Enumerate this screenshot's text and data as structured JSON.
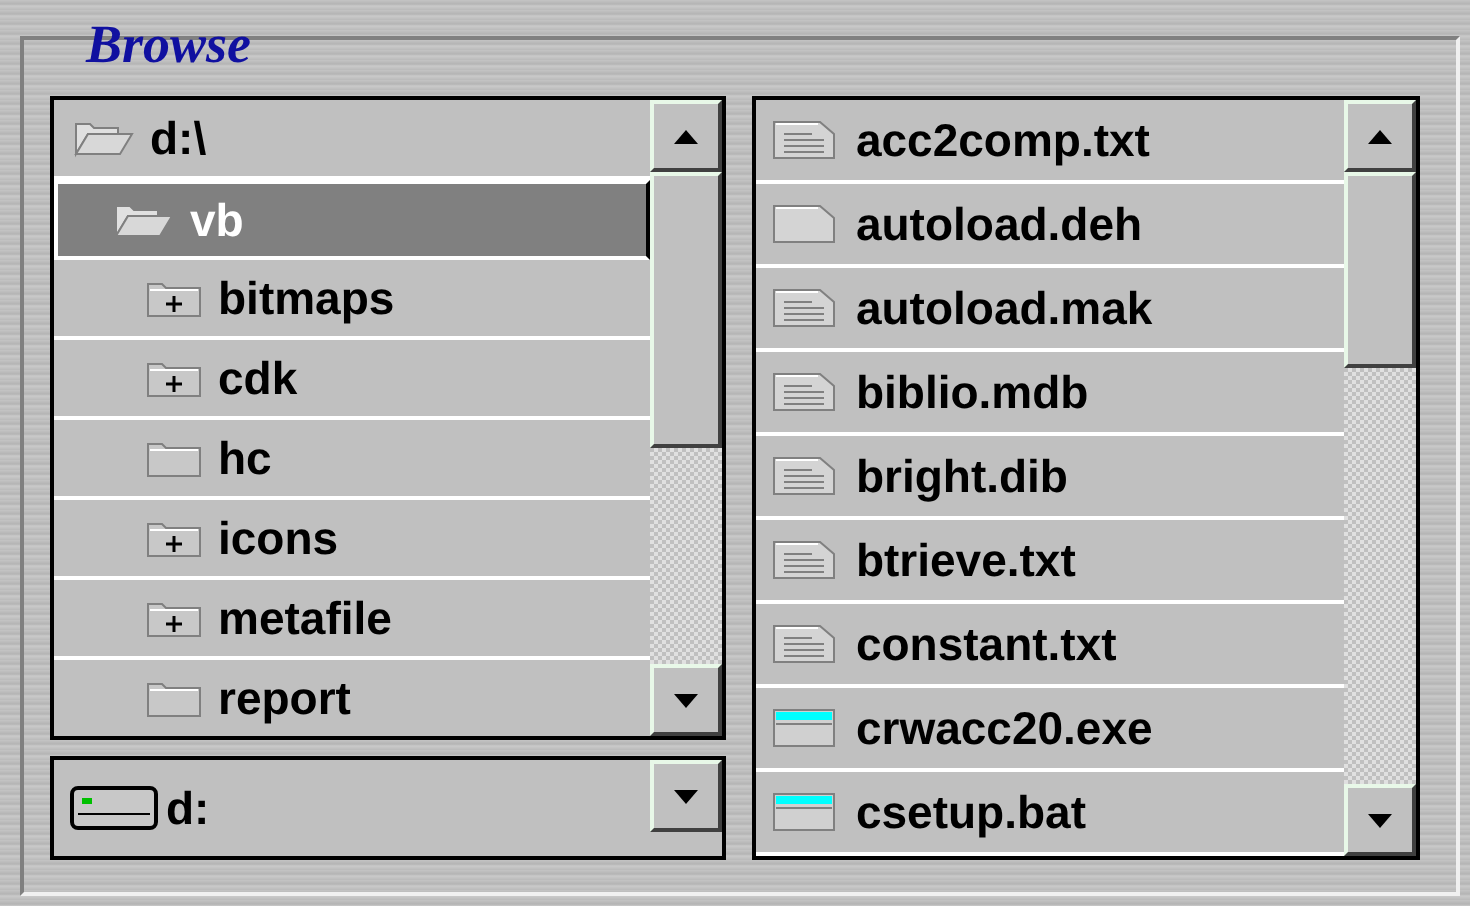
{
  "group": {
    "title": "Browse"
  },
  "folders": [
    {
      "name": "d:\\",
      "open": true,
      "expandable": false,
      "selected": false,
      "children": [
        {
          "name": "vb",
          "open": true,
          "expandable": false,
          "selected": true,
          "children": [
            {
              "name": "bitmaps",
              "open": false,
              "expandable": true,
              "selected": false
            },
            {
              "name": "cdk",
              "open": false,
              "expandable": true,
              "selected": false
            },
            {
              "name": "hc",
              "open": false,
              "expandable": false,
              "selected": false
            },
            {
              "name": "icons",
              "open": false,
              "expandable": true,
              "selected": false
            },
            {
              "name": "metafile",
              "open": false,
              "expandable": true,
              "selected": false
            },
            {
              "name": "report",
              "open": false,
              "expandable": false,
              "selected": false
            }
          ]
        }
      ]
    }
  ],
  "drive": {
    "value": "d:"
  },
  "files": [
    {
      "name": "acc2comp.txt",
      "kind": "text"
    },
    {
      "name": "autoload.deh",
      "kind": "blank"
    },
    {
      "name": "autoload.mak",
      "kind": "text"
    },
    {
      "name": "biblio.mdb",
      "kind": "text"
    },
    {
      "name": "bright.dib",
      "kind": "text"
    },
    {
      "name": "btrieve.txt",
      "kind": "text"
    },
    {
      "name": "constant.txt",
      "kind": "text"
    },
    {
      "name": "crwacc20.exe",
      "kind": "program"
    },
    {
      "name": "csetup.bat",
      "kind": "program"
    }
  ]
}
